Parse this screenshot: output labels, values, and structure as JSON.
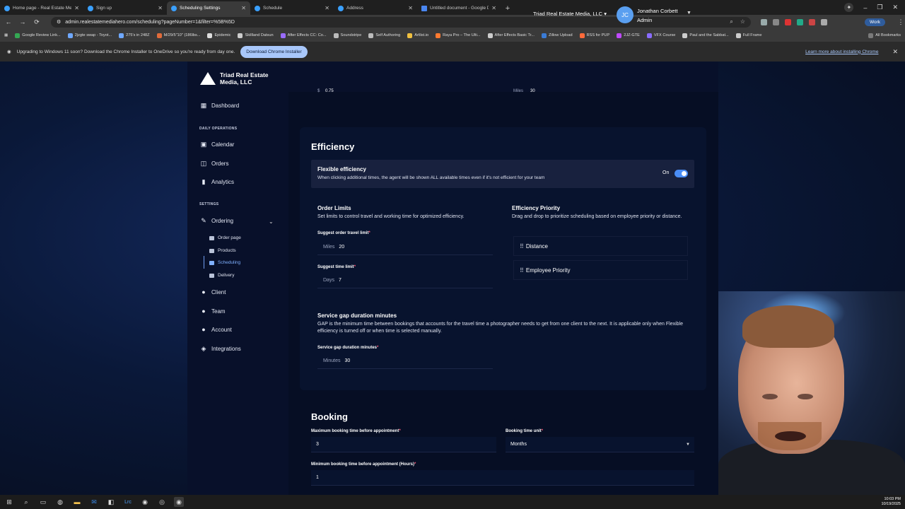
{
  "browser": {
    "tabs": [
      {
        "title": "Home page - Real Estate Media"
      },
      {
        "title": "Sign up"
      },
      {
        "title": "Scheduling Settings",
        "active": true
      },
      {
        "title": "Schedule"
      },
      {
        "title": "Address"
      },
      {
        "title": "Untitled document - Google Do"
      }
    ],
    "url": "admin.realestatemediahero.com/scheduling?pageNumber=1&filter=%5B%5D",
    "profile": "Work",
    "bookmarks": [
      "Google Review Link...",
      "2jzgte swap - Toyot...",
      "275's in 248Z",
      "M/29/5\"10\" (186lbs...",
      "Epidemic",
      "Skillland Datsun",
      "After Effects CC: Co...",
      "Soundstripe",
      "Self Authoring",
      "Artlist.io",
      "Raya Pro – The Ulti...",
      "After Effects Basic Tr...",
      "Zillow Upload",
      "RSS for PUP",
      "2JZ-GTE",
      "VFX Course",
      "Paul and the Sabbat...",
      "Full Frame"
    ],
    "all_bookmarks": "All Bookmarks",
    "infobar": {
      "message": "Upgrading to Windows 11 soon? Download the Chrome Installer to OneDrive so you're ready from day one.",
      "button": "Download Chrome Installer",
      "link": "Learn more about installing Chrome"
    }
  },
  "app": {
    "brand": "Triad Real Estate Media, LLC",
    "company_select": "Triad Real Estate Media, LLC",
    "user": {
      "initials": "JC",
      "name": "Jonathan Corbett",
      "role": "Admin"
    },
    "sidebar": {
      "dashboard": "Dashboard",
      "section_daily": "DAILY OPERATIONS",
      "calendar": "Calendar",
      "orders": "Orders",
      "analytics": "Analytics",
      "section_settings": "SETTINGS",
      "ordering": "Ordering",
      "order_page": "Order page",
      "products": "Products",
      "scheduling": "Scheduling",
      "delivery": "Delivery",
      "client": "Client",
      "team": "Team",
      "account": "Account",
      "integrations": "Integrations"
    },
    "top_ghost": {
      "left_unit": "$",
      "left_value": "0.75",
      "right_unit": "Miles",
      "right_value": "30"
    },
    "efficiency": {
      "title": "Efficiency",
      "flex_title": "Flexible efficiency",
      "flex_desc": "When clicking additional times, the agent will be shown ALL available times even if it's not efficient for your team",
      "flex_state": "On",
      "flex_enabled": true,
      "order_limits_title": "Order Limits",
      "order_limits_desc": "Set limits to control travel and working time for optimized efficiency.",
      "travel_label": "Suggest order travel limit",
      "travel_unit": "Miles",
      "travel_value": "20",
      "time_label": "Suggest time limit",
      "time_unit": "Days",
      "time_value": "7",
      "priority_title": "Efficiency Priority",
      "priority_desc": "Drag and drop to prioritize scheduling based on employee priority or distance.",
      "priority_items": [
        "Distance",
        "Employee Priority"
      ],
      "gap_title": "Service gap duration minutes",
      "gap_desc": "GAP is the minimum time between bookings that accounts for the travel time a photographer needs to get from one client to the next. It is applicable only when Flexible efficiency is turned off or when time is selected manually.",
      "gap_label": "Service gap duration minutes",
      "gap_unit": "Minutes",
      "gap_value": "30"
    },
    "booking": {
      "title": "Booking",
      "max_label": "Maximum booking time before appointment",
      "max_value": "3",
      "unit_label": "Booking time unit",
      "unit_value": "Months",
      "min_label": "Minimum booking time before appointment (Hours)",
      "min_value": "1"
    }
  },
  "taskbar": {
    "time": "10:03 PM",
    "date": "10/19/2025"
  }
}
